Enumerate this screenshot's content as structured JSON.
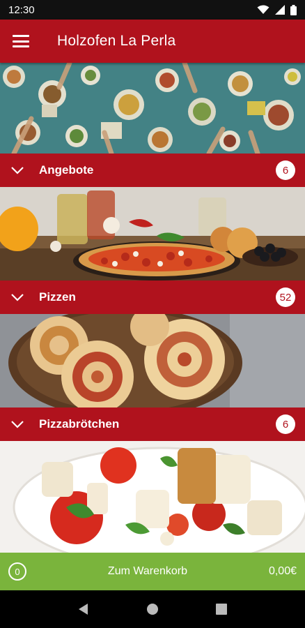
{
  "status_bar": {
    "time": "12:30"
  },
  "app_bar": {
    "title": "Holzofen La Perla"
  },
  "categories": [
    {
      "label": "Angebote",
      "count": "6"
    },
    {
      "label": "Pizzen",
      "count": "52"
    },
    {
      "label": "Pizzabrötchen",
      "count": "6"
    }
  ],
  "cart": {
    "count": "0",
    "label": "Zum Warenkorb",
    "total": "0,00€"
  },
  "colors": {
    "brand_red": "#b0121d",
    "cart_green": "#7ab43c"
  },
  "icons": [
    "menu-icon",
    "chevron-down-icon",
    "wifi-icon",
    "signal-icon",
    "battery-icon",
    "back-icon",
    "home-icon",
    "recents-icon"
  ]
}
